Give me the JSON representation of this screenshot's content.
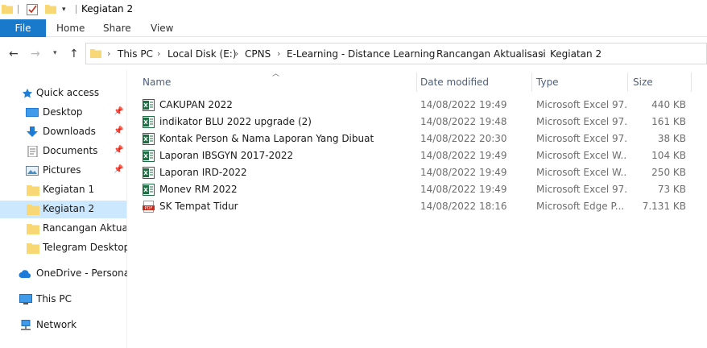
{
  "window": {
    "title": "Kegiatan 2"
  },
  "quick_access_toolbar": {
    "icons": [
      "folder-icon",
      "properties-icon",
      "new-folder-icon",
      "customize-dropdown-icon"
    ]
  },
  "ribbon": {
    "file_label": "File",
    "tabs": [
      "Home",
      "Share",
      "View"
    ],
    "file_color": "#1979ca"
  },
  "address_bar": {
    "crumbs": [
      "This PC",
      "Local Disk (E:)",
      "CPNS",
      "E-Learning - Distance Learning",
      "Rancangan Aktualisasi",
      "Kegiatan 2"
    ]
  },
  "nav_pane": {
    "quick_access": "Quick access",
    "items": [
      {
        "label": "Desktop",
        "icon": "desktop-icon",
        "pinned": true
      },
      {
        "label": "Downloads",
        "icon": "downloads-icon",
        "pinned": true
      },
      {
        "label": "Documents",
        "icon": "documents-icon",
        "pinned": true
      },
      {
        "label": "Pictures",
        "icon": "pictures-icon",
        "pinned": true
      },
      {
        "label": "Kegiatan 1",
        "icon": "folder-icon",
        "pinned": false
      },
      {
        "label": "Kegiatan 2",
        "icon": "folder-icon",
        "pinned": false,
        "selected": true
      },
      {
        "label": "Rancangan Aktualisasi",
        "icon": "folder-icon",
        "pinned": false
      },
      {
        "label": "Telegram Desktop",
        "icon": "folder-icon",
        "pinned": false
      }
    ],
    "onedrive": "OneDrive - Personal",
    "this_pc": "This PC",
    "network": "Network",
    "selected_color": "#cce8ff"
  },
  "file_list": {
    "columns": {
      "name": "Name",
      "date": "Date modified",
      "type": "Type",
      "size": "Size"
    },
    "rows": [
      {
        "name": "CAKUPAN 2022",
        "date": "14/08/2022 19:49",
        "type": "Microsoft Excel 97...",
        "size": "440 KB",
        "icon": "excel-icon"
      },
      {
        "name": "indikator BLU 2022 upgrade (2)",
        "date": "14/08/2022 19:48",
        "type": "Microsoft Excel 97...",
        "size": "161 KB",
        "icon": "excel-icon"
      },
      {
        "name": "Kontak Person & Nama Laporan Yang Dibuat",
        "date": "14/08/2022 20:30",
        "type": "Microsoft Excel 97...",
        "size": "38 KB",
        "icon": "excel-icon"
      },
      {
        "name": "Laporan IBSGYN 2017-2022",
        "date": "14/08/2022 19:49",
        "type": "Microsoft Excel W...",
        "size": "104 KB",
        "icon": "excel-icon"
      },
      {
        "name": "Laporan IRD-2022",
        "date": "14/08/2022 19:49",
        "type": "Microsoft Excel W...",
        "size": "250 KB",
        "icon": "excel-icon"
      },
      {
        "name": "Monev RM 2022",
        "date": "14/08/2022 19:49",
        "type": "Microsoft Excel 97...",
        "size": "73 KB",
        "icon": "excel-icon"
      },
      {
        "name": "SK Tempat Tidur",
        "date": "14/08/2022 18:16",
        "type": "Microsoft Edge P...",
        "size": "7.131 KB",
        "icon": "pdf-icon"
      }
    ]
  }
}
